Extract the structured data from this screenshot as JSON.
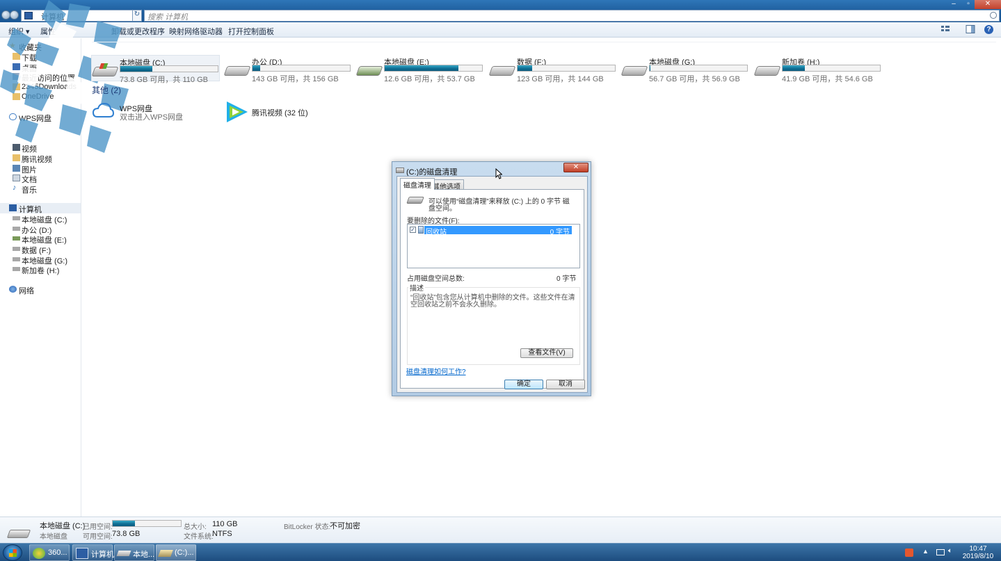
{
  "window": {
    "breadcrumb": "计算机",
    "search_placeholder": "搜索 计算机",
    "minimize": "–",
    "maximize": "▫",
    "close": "✕"
  },
  "toolbar": {
    "organize": "组织 ▾",
    "properties": "属性",
    "uninstall": "卸载或更改程序",
    "map_drive": "映射网络驱动器",
    "control_panel": "打开控制面板",
    "help": "?"
  },
  "sidebar": {
    "favorites": "收藏夹",
    "downloads_partial": "下载",
    "desktop": "桌面",
    "recent": "最近访问的位置",
    "download_folder": "2345Downloads",
    "onedrive": "OneDrive",
    "wps": "WPS网盘",
    "libraries": [
      {
        "label": "视频"
      },
      {
        "label": "腾讯视频"
      },
      {
        "label": "图片"
      },
      {
        "label": "文档"
      },
      {
        "label": "音乐"
      }
    ],
    "computer": "计算机",
    "drives": [
      {
        "label": "本地磁盘 (C:)"
      },
      {
        "label": "办公 (D:)"
      },
      {
        "label": "本地磁盘 (E:)"
      },
      {
        "label": "数据 (F:)"
      },
      {
        "label": "本地磁盘 (G:)"
      },
      {
        "label": "新加卷 (H:)"
      }
    ],
    "network": "网络"
  },
  "drives": [
    {
      "name": "本地磁盘 (C:)",
      "free": "73.8 GB 可用，共 110 GB",
      "used_fraction": 0.33
    },
    {
      "name": "办公 (D:)",
      "free": "143 GB 可用，共 156 GB",
      "used_fraction": 0.08
    },
    {
      "name": "本地磁盘 (E:)",
      "free": "12.6 GB 可用，共 53.7 GB",
      "used_fraction": 0.76
    },
    {
      "name": "数据 (F:)",
      "free": "123 GB 可用，共 144 GB",
      "used_fraction": 0.15
    },
    {
      "name": "本地磁盘 (G:)",
      "free": "56.7 GB 可用，共 56.9 GB",
      "used_fraction": 0.005
    },
    {
      "name": "新加卷 (H:)",
      "free": "41.9 GB 可用，共 54.6 GB",
      "used_fraction": 0.23
    }
  ],
  "other_group": {
    "heading": "其他 (2)",
    "items": [
      {
        "name": "WPS网盘",
        "sub": "双击进入WPS网盘"
      },
      {
        "name": "腾讯视频 (32 位)",
        "sub": ""
      }
    ]
  },
  "dialog": {
    "title": "(C:)的磁盘清理",
    "close": "✕",
    "tab_cleanup": "磁盘清理",
    "tab_more": "其他选项",
    "intro_line1": "可以使用“磁盘清理”来释放  (C:) 上的 0 字节 磁",
    "intro_line2": "盘空间。",
    "files_label": "要删除的文件(F):",
    "files": [
      {
        "name": "回收站",
        "size": "0 字节",
        "checked": "✓"
      }
    ],
    "total_label": "占用磁盘空间总数:",
    "total_value": "0 字节",
    "desc_label": "描述",
    "desc_line1": "“回收站”包含您从计算机中删除的文件。这些文件在清",
    "desc_line2": "空回收站之前不会永久删除。",
    "view_files": "查看文件(V)",
    "how_link": "磁盘清理如何工作?",
    "ok": "确定",
    "cancel": "取消"
  },
  "details": {
    "name": "本地磁盘 (C:)",
    "type": "本地磁盘",
    "used_label": "已用空间:",
    "free_label": "可用空间:",
    "free_value": "73.8 GB",
    "size_label": "总大小:",
    "size_value": "110 GB",
    "fs_label": "文件系统:",
    "fs_value": "NTFS",
    "bitlocker_label": "BitLocker 状态:",
    "bitlocker_value": "不可加密",
    "used_fraction": 0.33
  },
  "taskbar": {
    "items": [
      {
        "label": "360..."
      },
      {
        "label": "计算机"
      },
      {
        "label": "本地..."
      },
      {
        "label": "(C:)..."
      }
    ],
    "time": "10:47",
    "date": "2019/8/10"
  },
  "colors": {
    "accent": "#1b5a99",
    "bar_fill": "#0f6f94",
    "selection": "#3399ff"
  }
}
